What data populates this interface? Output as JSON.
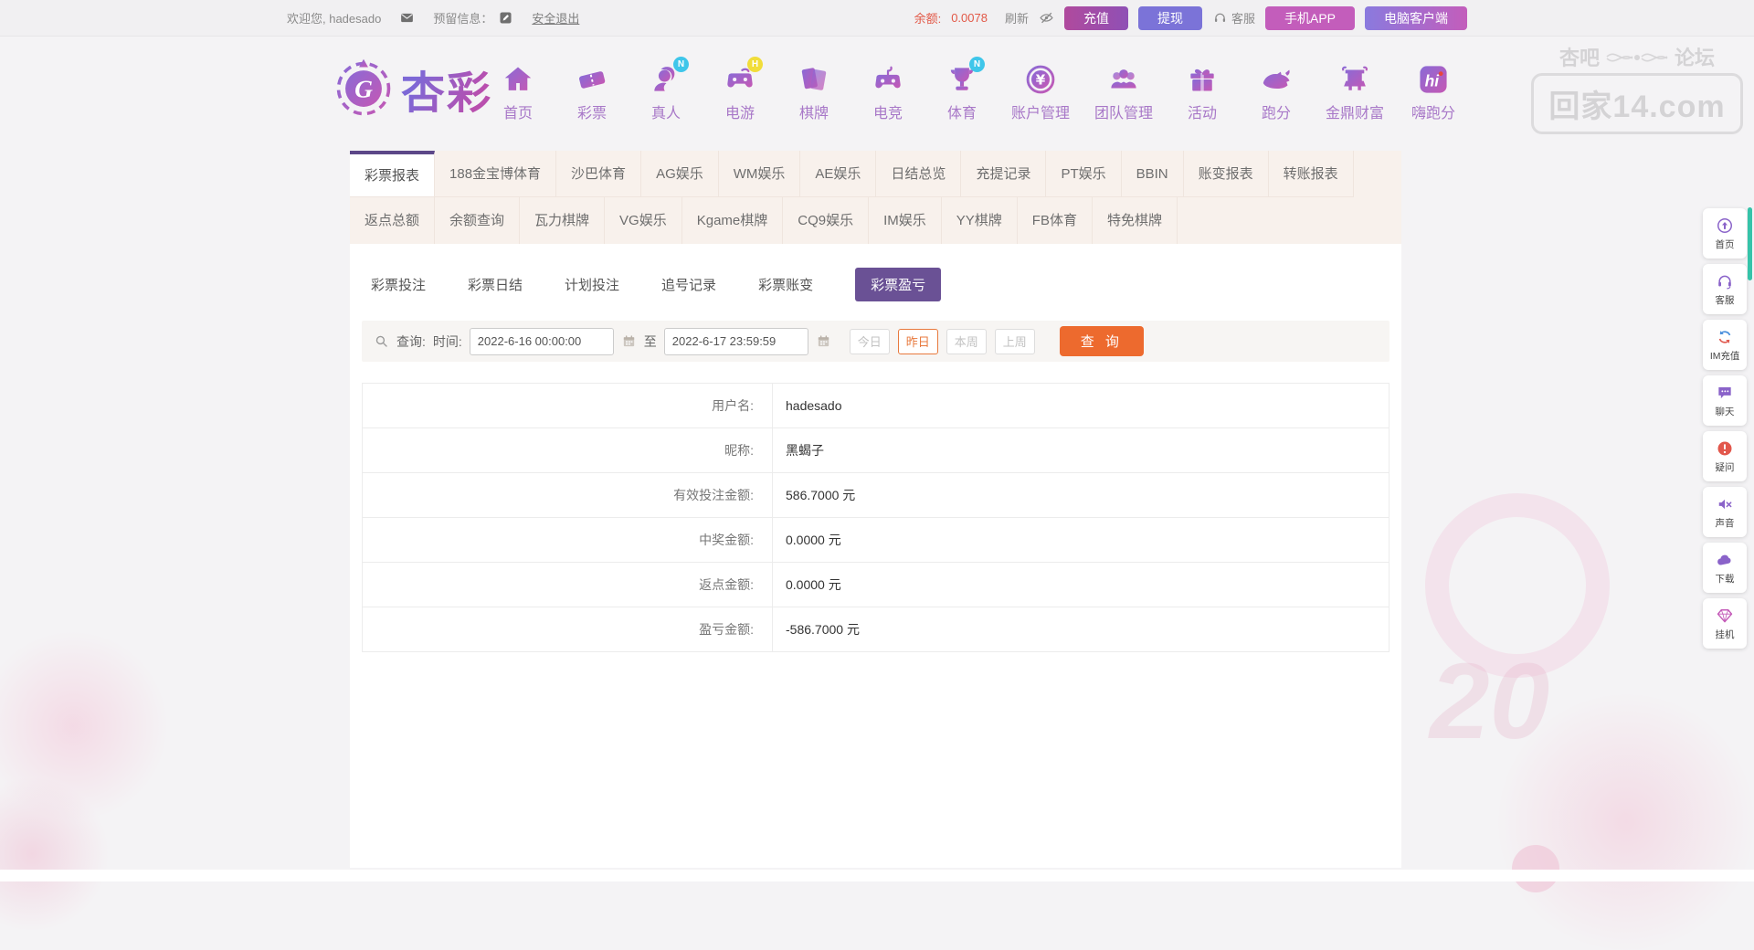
{
  "topbar": {
    "welcome": "欢迎您, hadesado",
    "reserved_label": "预留信息：",
    "logout": "安全退出",
    "balance_label": "余额:",
    "balance_value": "0.0078",
    "refresh_label": "刷新",
    "buttons": {
      "recharge": "充值",
      "withdraw": "提现",
      "service": "客服",
      "mobile_app": "手机APP",
      "pc_client": "电脑客户端"
    }
  },
  "brand": {
    "name": "杏彩"
  },
  "watermark": {
    "left": "杏吧",
    "right": "论坛",
    "domain": "回家14.com"
  },
  "nav": {
    "items": [
      {
        "label": "首页",
        "icon": "home-icon",
        "badge": null
      },
      {
        "label": "彩票",
        "icon": "ticket-icon",
        "badge": null
      },
      {
        "label": "真人",
        "icon": "live-person-icon",
        "badge": "N",
        "badge_color": "cyan"
      },
      {
        "label": "电游",
        "icon": "gamepad-icon",
        "badge": "H",
        "badge_color": "yellow"
      },
      {
        "label": "棋牌",
        "icon": "cards-icon",
        "badge": null
      },
      {
        "label": "电竞",
        "icon": "esports-icon",
        "badge": null
      },
      {
        "label": "体育",
        "icon": "trophy-icon",
        "badge": "N",
        "badge_color": "cyan"
      },
      {
        "label": "账户管理",
        "icon": "coin-icon",
        "badge": null
      },
      {
        "label": "团队管理",
        "icon": "team-icon",
        "badge": null
      },
      {
        "label": "活动",
        "icon": "gift-icon",
        "badge": null
      },
      {
        "label": "跑分",
        "icon": "rhino-icon",
        "badge": null
      },
      {
        "label": "金鼎财富",
        "icon": "ding-icon",
        "badge": null
      },
      {
        "label": "嗨跑分",
        "icon": "hi-app-icon",
        "badge": null
      }
    ]
  },
  "report_tabs": {
    "row1": [
      "彩票报表",
      "188金宝博体育",
      "沙巴体育",
      "AG娱乐",
      "WM娱乐",
      "AE娱乐",
      "日结总览",
      "充提记录",
      "PT娱乐",
      "BBIN",
      "账变报表",
      "转账报表"
    ],
    "row1_active": "彩票报表",
    "row2": [
      "返点总额",
      "余额查询",
      "瓦力棋牌",
      "VG娱乐",
      "Kgame棋牌",
      "CQ9娱乐",
      "IM娱乐",
      "YY棋牌",
      "FB体育",
      "特免棋牌"
    ],
    "row2_active": null
  },
  "subtabs": {
    "items": [
      "彩票投注",
      "彩票日结",
      "计划投注",
      "追号记录",
      "彩票账变",
      "彩票盈亏"
    ],
    "active": "彩票盈亏"
  },
  "query": {
    "search_label": "查询:",
    "time_label": "时间:",
    "start_value": "2022-6-16 00:00:00",
    "to_label": "至",
    "end_value": "2022-6-17 23:59:59",
    "quick_buttons": [
      "今日",
      "昨日",
      "本周",
      "上周"
    ],
    "quick_active": "昨日",
    "submit_label": "查 询"
  },
  "profit_table": {
    "rows": [
      {
        "label": "用户名:",
        "value": "hadesado"
      },
      {
        "label": "昵称:",
        "value": "黑蝎子"
      },
      {
        "label": "有效投注金额:",
        "value": "586.7000 元"
      },
      {
        "label": "中奖金额:",
        "value": "0.0000 元"
      },
      {
        "label": "返点金额:",
        "value": "0.0000 元"
      },
      {
        "label": "盈亏金额:",
        "value": "-586.7000 元"
      }
    ]
  },
  "side_tools": [
    {
      "label": "首页",
      "icon": "circle-up-icon"
    },
    {
      "label": "客服",
      "icon": "headset-icon"
    },
    {
      "label": "IM充值",
      "icon": "refresh-icon"
    },
    {
      "label": "聊天",
      "icon": "chat-icon"
    },
    {
      "label": "疑问",
      "icon": "exclamation-icon"
    },
    {
      "label": "声音",
      "icon": "mute-icon"
    },
    {
      "label": "下载",
      "icon": "cloud-icon"
    },
    {
      "label": "挂机",
      "icon": "gem-icon"
    }
  ],
  "decor": {
    "numeral": "20"
  },
  "colors": {
    "accent_purple": "#5c4788",
    "subtab_active_bg": "#6a5195",
    "submit_orange": "#ed6a2e",
    "quick_active_orange": "#e8793d",
    "balance_red": "#e25847",
    "scrollbar_teal": "#35c3a9",
    "tabstrip_bg": "#f8f1ec",
    "nav_label_purple": "#a878c8"
  }
}
